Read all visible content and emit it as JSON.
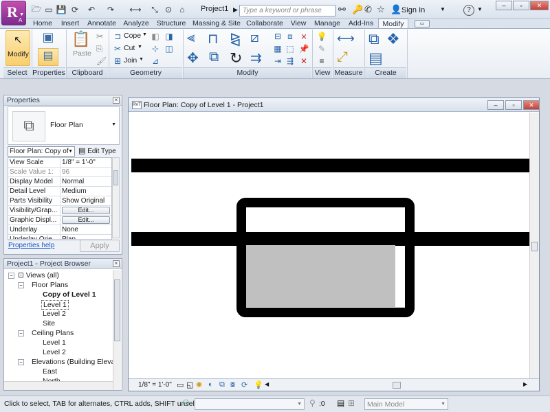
{
  "app": {
    "logo_letter": "R",
    "logo_sub": "A",
    "title": "Project1",
    "search_placeholder": "Type a keyword or phrase",
    "sign_in": "Sign In",
    "help": "?"
  },
  "tabs": [
    "Home",
    "Insert",
    "Annotate",
    "Analyze",
    "Structure",
    "Massing & Site",
    "Collaborate",
    "View",
    "Manage",
    "Add-Ins",
    "Modify"
  ],
  "ribbon": {
    "panels": [
      "Select",
      "Properties",
      "Clipboard",
      "Geometry",
      "Modify",
      "View",
      "Measure",
      "Create"
    ],
    "modify_label": "Modify",
    "paste_label": "Paste",
    "cope_label": "Cope",
    "cut_label": "Cut",
    "join_label": "Join"
  },
  "properties": {
    "header": "Properties",
    "type_name": "Floor Plan",
    "instance_selector": "Floor Plan: Copy of",
    "edit_type": "Edit Type",
    "rows": [
      {
        "k": "View Scale",
        "v": "1/8\" = 1'-0\""
      },
      {
        "k": "Scale Value   1:",
        "v": "96"
      },
      {
        "k": "Display Model",
        "v": "Normal"
      },
      {
        "k": "Detail Level",
        "v": "Medium"
      },
      {
        "k": "Parts Visibility",
        "v": "Show Original"
      },
      {
        "k": "Visibility/Grap...",
        "v": "Edit..."
      },
      {
        "k": "Graphic Displ...",
        "v": "Edit..."
      },
      {
        "k": "Underlay",
        "v": "None"
      },
      {
        "k": "Underlay Orie...",
        "v": "Plan"
      }
    ],
    "help_link": "Properties help",
    "apply": "Apply"
  },
  "browser": {
    "header": "Project1 - Project Browser",
    "nodes": [
      "Views (all)",
      "Floor Plans",
      "Copy of Level 1",
      "Level 1",
      "Level 2",
      "Site",
      "Ceiling Plans",
      "Level 1",
      "Level 2",
      "Elevations (Building Elevatio",
      "East",
      "North"
    ]
  },
  "view": {
    "title": "Floor Plan: Copy of Level 1 - Project1",
    "scale": "1/8\" = 1'-0\""
  },
  "status": {
    "hint": "Click to select, TAB for alternates, CTRL adds, SHIFT unselects",
    "filter_count": ":0",
    "model": "Main Model"
  },
  "colors": {
    "accent": "#2764a8",
    "ribbon_bg": "#eef2f7",
    "logo": "#9b3aa5",
    "fill_gray": "#c0c0c0"
  }
}
